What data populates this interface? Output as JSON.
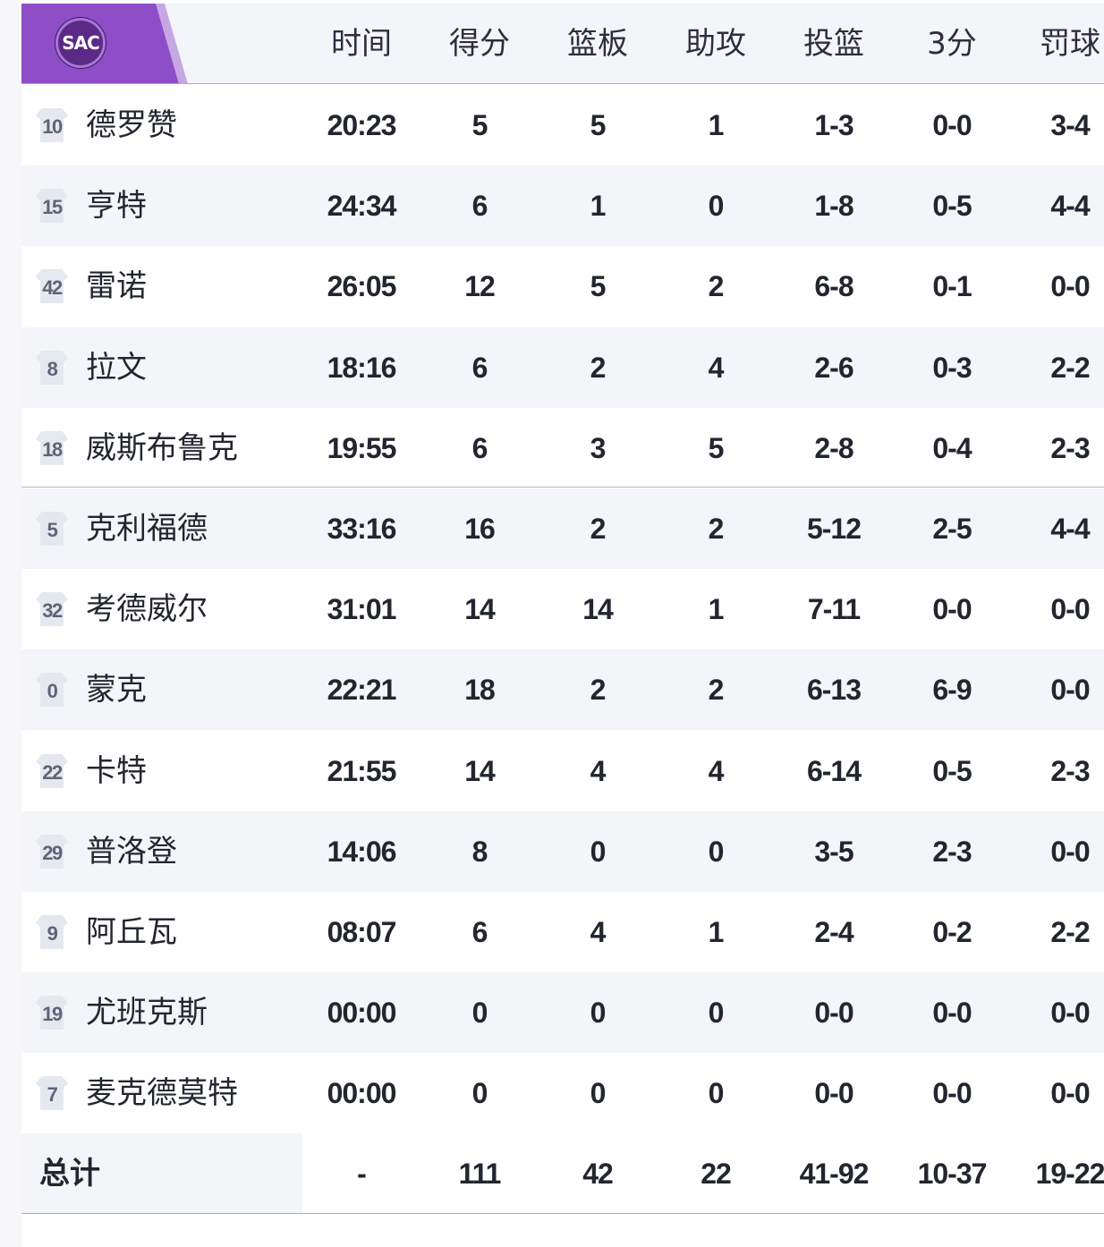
{
  "team": {
    "abbr": "SAC",
    "color_primary": "#8d4ec7",
    "color_dark": "#5b2a86"
  },
  "columns": [
    "时间",
    "得分",
    "篮板",
    "助攻",
    "投篮",
    "3分",
    "罚球"
  ],
  "players": [
    {
      "number": "10",
      "name": "德罗赞",
      "stats": [
        "20:23",
        "5",
        "5",
        "1",
        "1-3",
        "0-0",
        "3-4"
      ]
    },
    {
      "number": "15",
      "name": "亨特",
      "stats": [
        "24:34",
        "6",
        "1",
        "0",
        "1-8",
        "0-5",
        "4-4"
      ]
    },
    {
      "number": "42",
      "name": "雷诺",
      "stats": [
        "26:05",
        "12",
        "5",
        "2",
        "6-8",
        "0-1",
        "0-0"
      ]
    },
    {
      "number": "8",
      "name": "拉文",
      "stats": [
        "18:16",
        "6",
        "2",
        "4",
        "2-6",
        "0-3",
        "2-2"
      ]
    },
    {
      "number": "18",
      "name": "威斯布鲁克",
      "stats": [
        "19:55",
        "6",
        "3",
        "5",
        "2-8",
        "0-4",
        "2-3"
      ]
    },
    {
      "number": "5",
      "name": "克利福德",
      "stats": [
        "33:16",
        "16",
        "2",
        "2",
        "5-12",
        "2-5",
        "4-4"
      ]
    },
    {
      "number": "32",
      "name": "考德威尔",
      "stats": [
        "31:01",
        "14",
        "14",
        "1",
        "7-11",
        "0-0",
        "0-0"
      ]
    },
    {
      "number": "0",
      "name": "蒙克",
      "stats": [
        "22:21",
        "18",
        "2",
        "2",
        "6-13",
        "6-9",
        "0-0"
      ]
    },
    {
      "number": "22",
      "name": "卡特",
      "stats": [
        "21:55",
        "14",
        "4",
        "4",
        "6-14",
        "0-5",
        "2-3"
      ]
    },
    {
      "number": "29",
      "name": "普洛登",
      "stats": [
        "14:06",
        "8",
        "0",
        "0",
        "3-5",
        "2-3",
        "0-0"
      ]
    },
    {
      "number": "9",
      "name": "阿丘瓦",
      "stats": [
        "08:07",
        "6",
        "4",
        "1",
        "2-4",
        "0-2",
        "2-2"
      ]
    },
    {
      "number": "19",
      "name": "尤班克斯",
      "stats": [
        "00:00",
        "0",
        "0",
        "0",
        "0-0",
        "0-0",
        "0-0"
      ]
    },
    {
      "number": "7",
      "name": "麦克德莫特",
      "stats": [
        "00:00",
        "0",
        "0",
        "0",
        "0-0",
        "0-0",
        "0-0"
      ]
    }
  ],
  "totals": {
    "label": "总计",
    "stats": [
      "-",
      "111",
      "42",
      "22",
      "41-92",
      "10-37",
      "19-22"
    ]
  }
}
